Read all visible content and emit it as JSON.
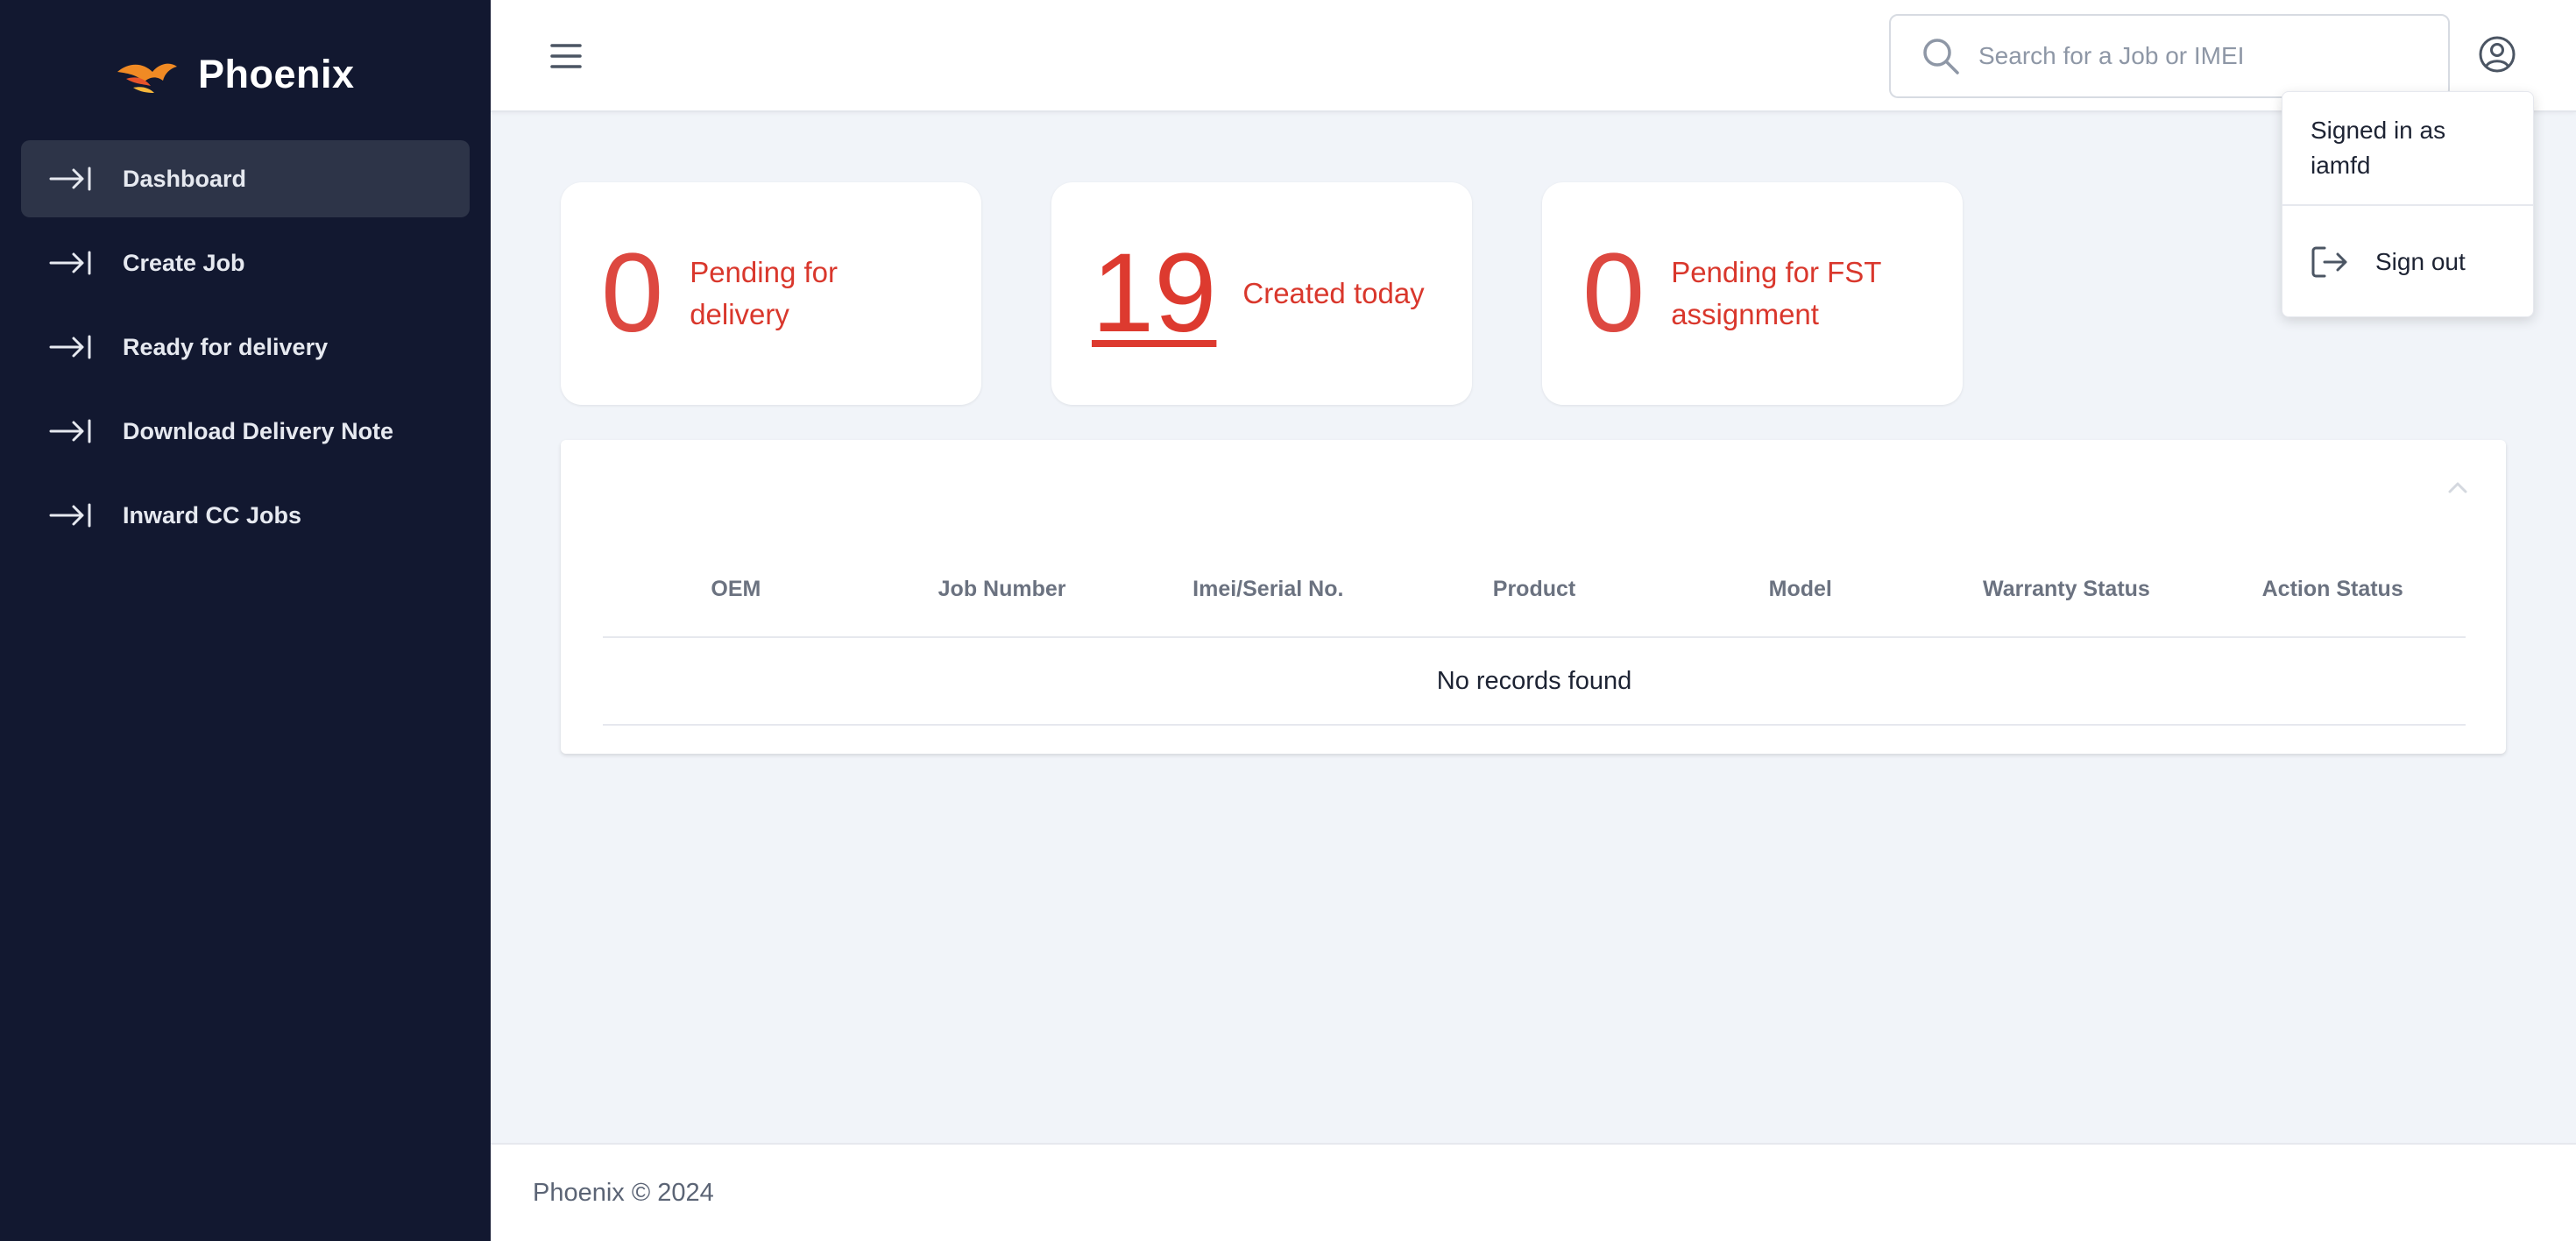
{
  "brand": {
    "name": "Phoenix"
  },
  "sidebar": {
    "items": [
      {
        "label": "Dashboard",
        "active": true
      },
      {
        "label": "Create Job"
      },
      {
        "label": "Ready for delivery"
      },
      {
        "label": "Download Delivery Note"
      },
      {
        "label": "Inward CC Jobs"
      }
    ]
  },
  "header": {
    "search": {
      "placeholder": "Search for a Job or IMEI",
      "value": ""
    }
  },
  "user_menu": {
    "signed_in_text": "Signed in as iamfd",
    "signout_label": "Sign out"
  },
  "stats": [
    {
      "value": "0",
      "label": "Pending for delivery"
    },
    {
      "value": "19",
      "label": "Created today"
    },
    {
      "value": "0",
      "label": "Pending for FST assignment"
    }
  ],
  "table": {
    "columns": [
      "OEM",
      "Job Number",
      "Imei/Serial No.",
      "Product",
      "Model",
      "Warranty Status",
      "Action Status"
    ],
    "empty_text": "No records found"
  },
  "footer": {
    "text": "Phoenix © 2024"
  },
  "colors": {
    "sidebar_bg": "#121830",
    "accent_red": "#dd3a2f",
    "page_bg": "#f1f4f9"
  },
  "icons": {
    "brand": "phoenix-logo",
    "nav": "arrow-to-right-icon",
    "menu": "hamburger-icon",
    "search": "search-icon",
    "user": "user-circle-icon",
    "signout": "sign-out-icon",
    "collapse": "chevron-up-icon"
  }
}
